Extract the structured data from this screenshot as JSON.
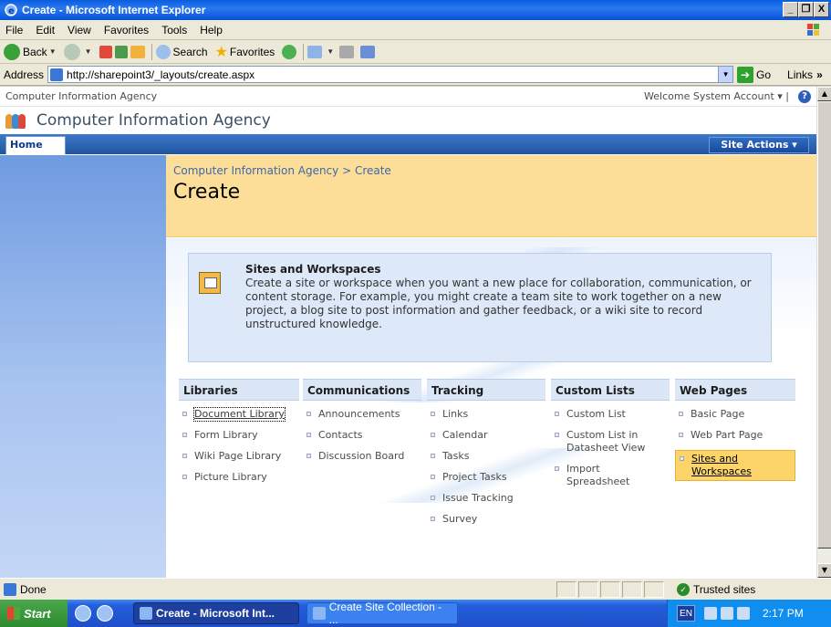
{
  "window": {
    "title": "Create - Microsoft Internet Explorer",
    "buttons": [
      "_",
      "Š",
      "X"
    ]
  },
  "menu": {
    "items": [
      "File",
      "Edit",
      "View",
      "Favorites",
      "Tools",
      "Help"
    ]
  },
  "toolbar": {
    "back": "Back",
    "search": "Search",
    "favorites": "Favorites"
  },
  "address": {
    "label": "Address",
    "url": "http://sharepoint3/_layouts/create.aspx",
    "go": "Go",
    "links": "Links"
  },
  "site": {
    "top_title": "Computer Information Agency",
    "welcome": "Welcome System Account ▾ |",
    "title": "Computer Information Agency",
    "home_tab": "Home",
    "site_actions": "Site Actions ▾"
  },
  "page": {
    "breadcrumb": "Computer Information Agency > Create",
    "title": "Create",
    "sites_heading": "Sites and Workspaces",
    "sites_desc": "Create a site or workspace when you want a new place for collaboration, communication, or content storage. For example, you might create a team site to work together on a new project, a blog site to post information and gather feedback, or a wiki site to record unstructured knowledge."
  },
  "columns": [
    {
      "heading": "Libraries",
      "items": [
        "Document Library",
        "Form Library",
        "Wiki Page Library",
        "Picture Library"
      ]
    },
    {
      "heading": "Communications",
      "items": [
        "Announcements",
        "Contacts",
        "Discussion Board"
      ]
    },
    {
      "heading": "Tracking",
      "items": [
        "Links",
        "Calendar",
        "Tasks",
        "Project Tasks",
        "Issue Tracking",
        "Survey"
      ]
    },
    {
      "heading": "Custom Lists",
      "items": [
        "Custom List",
        "Custom List in Datasheet View",
        "Import Spreadsheet"
      ]
    },
    {
      "heading": "Web Pages",
      "items": [
        "Basic Page",
        "Web Part Page",
        "Sites and Workspaces"
      ]
    }
  ],
  "status": {
    "text": "Done",
    "zone": "Trusted sites"
  },
  "taskbar": {
    "start": "Start",
    "task1": "Create - Microsoft Int...",
    "task2": "Create Site Collection - ...",
    "lang": "EN",
    "clock": "2:17 PM"
  }
}
